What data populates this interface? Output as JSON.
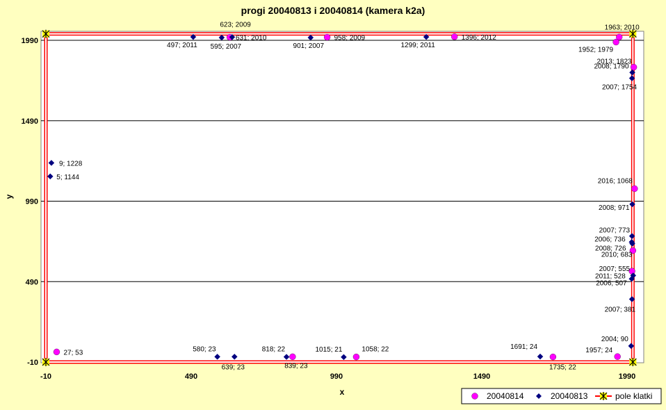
{
  "chart_data": {
    "type": "scatter",
    "title": "progi 20040813 i 20040814 (kamera k2a)",
    "xlabel": "x",
    "ylabel": "y",
    "xlim": [
      -10,
      2010
    ],
    "ylim": [
      -10,
      2030
    ],
    "xticks": [
      -10,
      490,
      990,
      1490,
      1990
    ],
    "yticks": [
      -10,
      490,
      990,
      1490,
      1990
    ],
    "grid": "horizontal",
    "legend_position": "bottom-right",
    "series": [
      {
        "name": "20040814",
        "color": "#ff00ff",
        "marker": "circle",
        "points": [
          {
            "x": 27,
            "y": 53,
            "label": "27; 53"
          },
          {
            "x": 623,
            "y": 2009,
            "label": "623; 2009"
          },
          {
            "x": 958,
            "y": 2009,
            "label": "958; 2009"
          },
          {
            "x": 1396,
            "y": 2012,
            "label": "1396; 2012"
          },
          {
            "x": 1963,
            "y": 2010,
            "label": "1963; 2010"
          },
          {
            "x": 1952,
            "y": 1979,
            "label": "1952; 1979"
          },
          {
            "x": 2013,
            "y": 1823,
            "label": "2013; 1823"
          },
          {
            "x": 2016,
            "y": 1068,
            "label": "2016; 1068"
          },
          {
            "x": 2010,
            "y": 683,
            "label": "2010; 683"
          },
          {
            "x": 2007,
            "y": 555,
            "label": "2007; 555"
          },
          {
            "x": 839,
            "y": 23,
            "label": "839; 23"
          },
          {
            "x": 1058,
            "y": 22,
            "label": "1058; 22"
          },
          {
            "x": 1735,
            "y": 22,
            "label": "1735; 22"
          },
          {
            "x": 1957,
            "y": 24,
            "label": "1957; 24"
          }
        ]
      },
      {
        "name": "20040813",
        "color": "#000080",
        "marker": "diamond",
        "points": [
          {
            "x": 497,
            "y": 2011,
            "label": "497; 2011"
          },
          {
            "x": 595,
            "y": 2007,
            "label": "595; 2007"
          },
          {
            "x": 631,
            "y": 2010,
            "label": "631; 2010"
          },
          {
            "x": 901,
            "y": 2007,
            "label": "901; 2007"
          },
          {
            "x": 1299,
            "y": 2011,
            "label": "1299; 2011"
          },
          {
            "x": 2008,
            "y": 1790,
            "label": "2008; 1790"
          },
          {
            "x": 2007,
            "y": 1754,
            "label": "2007; 1754"
          },
          {
            "x": 9,
            "y": 1228,
            "label": "9; 1228"
          },
          {
            "x": 5,
            "y": 1144,
            "label": "5; 1144"
          },
          {
            "x": 2008,
            "y": 971,
            "label": "2008; 971"
          },
          {
            "x": 2007,
            "y": 773,
            "label": "2007; 773"
          },
          {
            "x": 2006,
            "y": 736,
            "label": "2006; 736"
          },
          {
            "x": 2008,
            "y": 726,
            "label": "2008; 726"
          },
          {
            "x": 2011,
            "y": 528,
            "label": "2011; 528"
          },
          {
            "x": 2006,
            "y": 507,
            "label": "2006; 507"
          },
          {
            "x": 2007,
            "y": 381,
            "label": "2007; 381"
          },
          {
            "x": 2004,
            "y": 90,
            "label": "2004; 90"
          },
          {
            "x": 580,
            "y": 23,
            "label": "580; 23"
          },
          {
            "x": 639,
            "y": 23,
            "label": "639; 23"
          },
          {
            "x": 818,
            "y": 22,
            "label": "818; 22"
          },
          {
            "x": 1015,
            "y": 21,
            "label": "1015; 21"
          },
          {
            "x": 1691,
            "y": 24,
            "label": "1691; 24"
          }
        ]
      },
      {
        "name": "pole klatki",
        "color": "#ff0000",
        "marker_color": "#ffff00",
        "marker": "star",
        "line": true,
        "points": [
          {
            "x": -10,
            "y": -10
          },
          {
            "x": -10,
            "y": 2030
          },
          {
            "x": 2010,
            "y": 2030
          },
          {
            "x": 2010,
            "y": -10
          },
          {
            "x": -10,
            "y": -10
          }
        ]
      }
    ]
  }
}
